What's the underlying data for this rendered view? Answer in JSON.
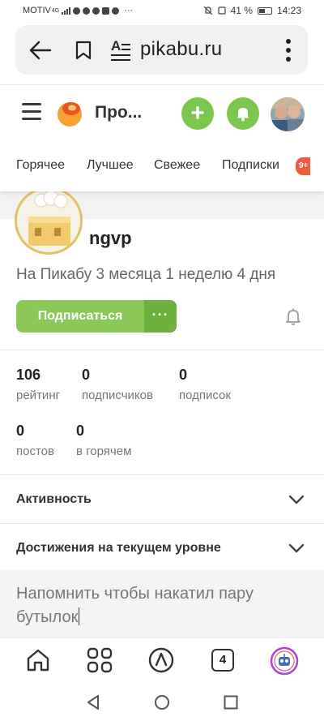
{
  "status_bar": {
    "carrier": "MOTIV",
    "network": "4G",
    "battery_percent": "41 %",
    "time": "14:23",
    "more": "···"
  },
  "browser": {
    "url": "pikabu.ru",
    "reader_glyph": "A"
  },
  "header": {
    "site_title": "Про...",
    "add_label": "+",
    "accent_color": "#7bc74d"
  },
  "tabs": [
    {
      "label": "Горячее"
    },
    {
      "label": "Лучшее"
    },
    {
      "label": "Свежее"
    },
    {
      "label": "Подписки"
    }
  ],
  "tabs_badge": "9+",
  "profile": {
    "username": "ngvp",
    "tenure": "На Пикабу 3 месяца 1 неделю 4 дня",
    "subscribe_label": "Подписаться",
    "more_label": "···",
    "stats_row1": [
      {
        "value": "106",
        "label": "рейтинг"
      },
      {
        "value": "0",
        "label": "подписчиков"
      },
      {
        "value": "0",
        "label": "подписок"
      }
    ],
    "stats_row2": [
      {
        "value": "0",
        "label": "постов"
      },
      {
        "value": "0",
        "label": "в горячем"
      }
    ]
  },
  "sections": {
    "activity": "Активность",
    "achievements": "Достижения на текущем уровне"
  },
  "note": {
    "line1": "Напомнить чтобы накатил пару",
    "line2": "бутылок"
  },
  "bottom_nav": {
    "tabs_count": "4"
  }
}
